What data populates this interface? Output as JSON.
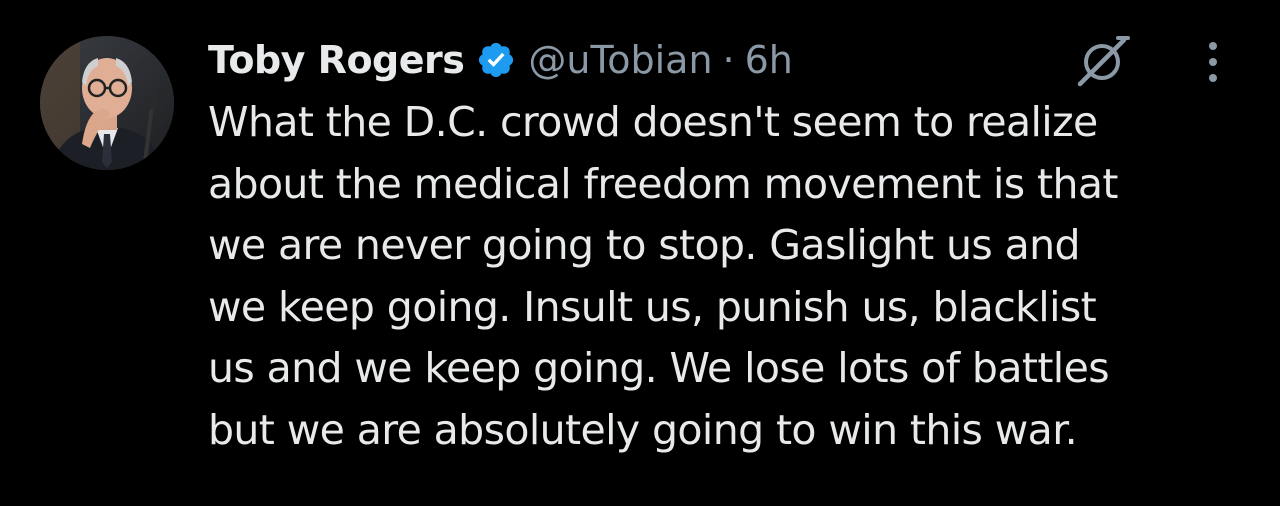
{
  "tweet": {
    "author": {
      "name": "Toby Rogers",
      "handle": "@uTobian",
      "verified": true,
      "avatar": "avatar-photo"
    },
    "separator": "·",
    "time": "6h",
    "text": "What the D.C. crowd doesn't seem to realize\nabout the medical freedom movement is that\nwe are never going to stop. Gaslight us and\nwe keep going. Insult us, punish us, blacklist\nus and we keep going. We lose lots of battles\nbut we are absolutely going to win this war.",
    "icons": {
      "verified": "verified-badge-icon",
      "grok": "grok-icon",
      "more": "more-options-icon"
    }
  },
  "colors": {
    "background": "#000000",
    "text_primary": "#e7e9ea",
    "text_secondary": "#8b98a5",
    "verified_blue": "#1d9bf0"
  }
}
